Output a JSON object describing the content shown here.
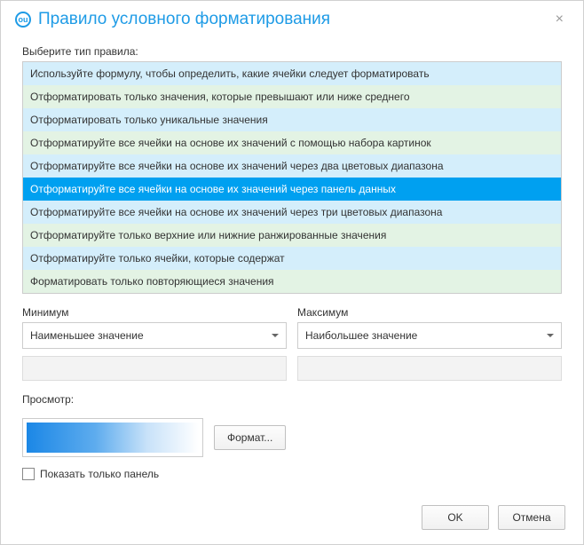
{
  "window": {
    "title": "Правило условного форматирования",
    "close": "×",
    "app_icon_initials": "ou"
  },
  "rule": {
    "prompt": "Выберите тип правила:",
    "items": [
      "Используйте формулу, чтобы определить, какие ячейки следует форматировать",
      "Отформатировать только значения, которые превышают или ниже среднего",
      "Отформатировать только уникальные значения",
      "Отформатируйте все ячейки на основе их значений с помощью набора картинок",
      "Отформатируйте все ячейки на основе их значений через два цветовых диапазона",
      "Отформатируйте все ячейки на основе их значений через панель данных",
      "Отформатируйте все ячейки на основе их значений через три цветовых диапазона",
      "Отформатируйте только верхние или нижние ранжированные значения",
      "Отформатируйте только ячейки, которые содержат",
      "Форматировать только повторяющиеся значения"
    ],
    "selected_index": 5
  },
  "minmax": {
    "min_label": "Минимум",
    "max_label": "Максимум",
    "min_value": "Наименьшее значение",
    "max_value": "Наибольшее значение"
  },
  "preview": {
    "label": "Просмотр:",
    "format_button": "Формат..."
  },
  "checkbox": {
    "label": "Показать только панель"
  },
  "buttons": {
    "ok": "OK",
    "cancel": "Отмена"
  }
}
